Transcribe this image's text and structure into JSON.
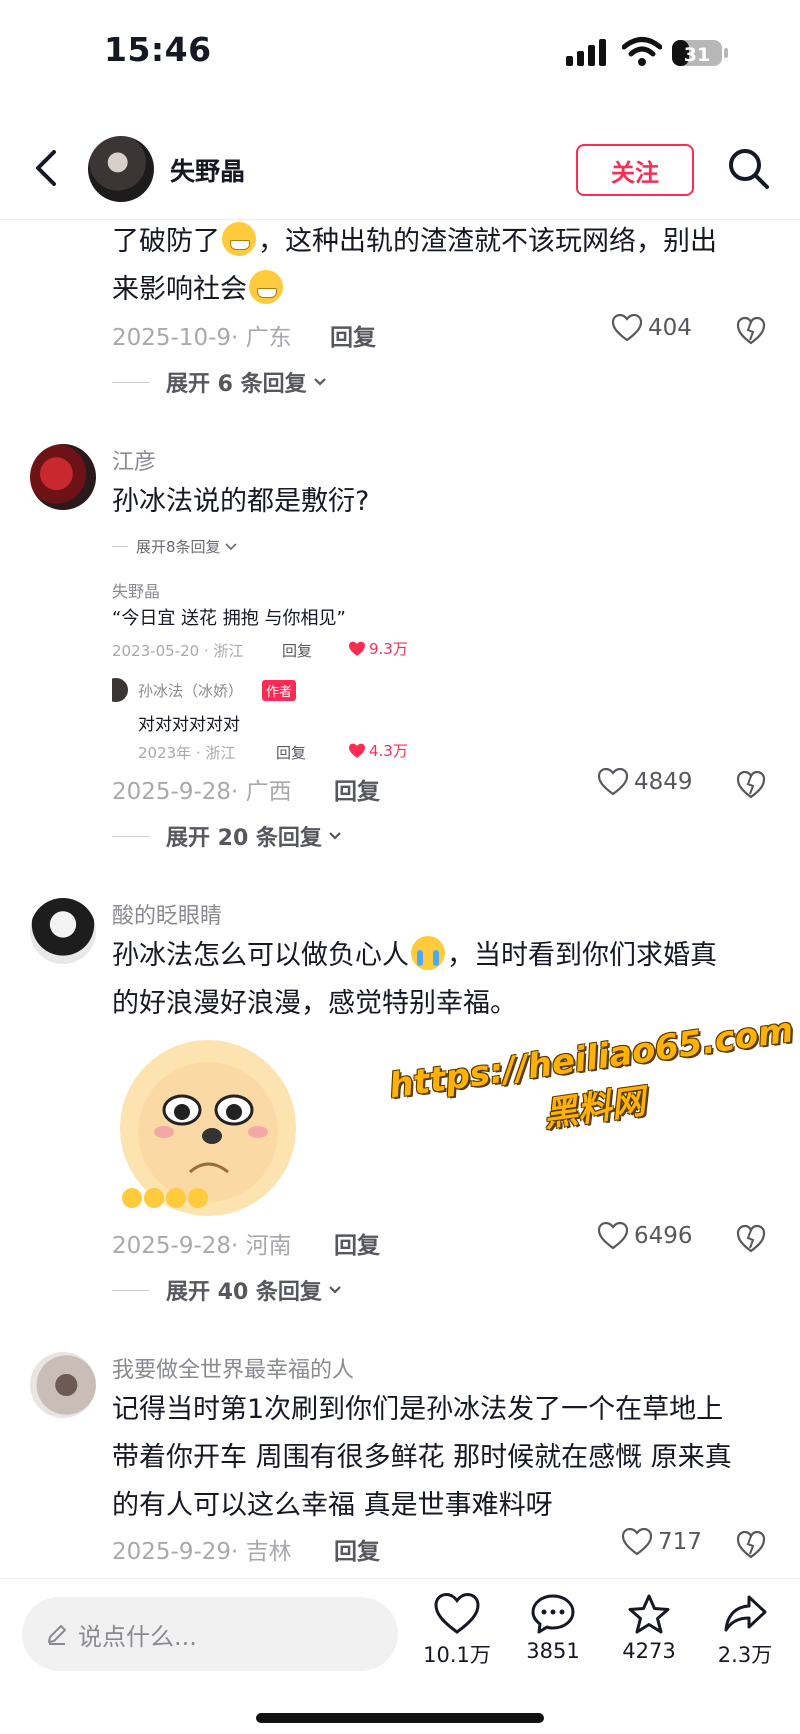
{
  "status_bar": {
    "time": "15:46",
    "battery": "31"
  },
  "header": {
    "username": "失野晶",
    "follow_label": "关注"
  },
  "comments": [
    {
      "text_part1": "了破防了",
      "text_part2": "，这种出轨的渣渣就不该玩网络，别出",
      "text_part3": "来影响社会",
      "date": "2025-10-9· 广东",
      "reply_label": "回复",
      "likes": "404",
      "expand_label": "展开 6 条回复"
    },
    {
      "username": "江彦",
      "text": "孙冰法说的都是敷衍?",
      "embedded": {
        "expand_label": "展开8条回复",
        "user": "失野晶",
        "text": "“今日宜 送花 拥抱 与你相见”",
        "meta": "2023-05-20 · 浙江",
        "reply": "回复",
        "likes": "9.3万",
        "user2": "孙冰法（冰娇）",
        "badge": "作者",
        "text2": "对对对对对对",
        "meta2": "2023年 · 浙江",
        "reply2": "回复",
        "likes2": "4.3万"
      },
      "date": "2025-9-28· 广西",
      "reply_label": "回复",
      "likes": "4849",
      "expand_label": "展开 20 条回复"
    },
    {
      "username": "酸的眨眼睛",
      "text_line1_a": "孙冰法怎么可以做负心人",
      "text_line1_b": "，当时看到你们求婚真",
      "text_line2": "的好浪漫好浪漫，感觉特别幸福。",
      "date": "2025-9-28· 河南",
      "reply_label": "回复",
      "likes": "6496",
      "expand_label": "展开 40 条回复"
    },
    {
      "username": "我要做全世界最幸福的人",
      "text_lines": [
        "记得当时第1次刷到你们是孙冰法发了一个在草地上",
        "带着你开车 周围有很多鲜花 那时候就在感慨 原来真",
        "的有人可以这么幸福 真是世事难料呀"
      ],
      "date": "2025-9-29· 吉林",
      "reply_label": "回复",
      "likes": "717"
    }
  ],
  "watermark": {
    "line1": "https://heiliao65.com",
    "line2": "黑料网"
  },
  "bottom_bar": {
    "input_placeholder": "说点什么...",
    "likes": "10.1万",
    "comments": "3851",
    "favorites": "4273",
    "shares": "2.3万"
  },
  "colors": {
    "accent": "#fe2c55",
    "text": "#161823",
    "muted": "#a8a9ad"
  }
}
